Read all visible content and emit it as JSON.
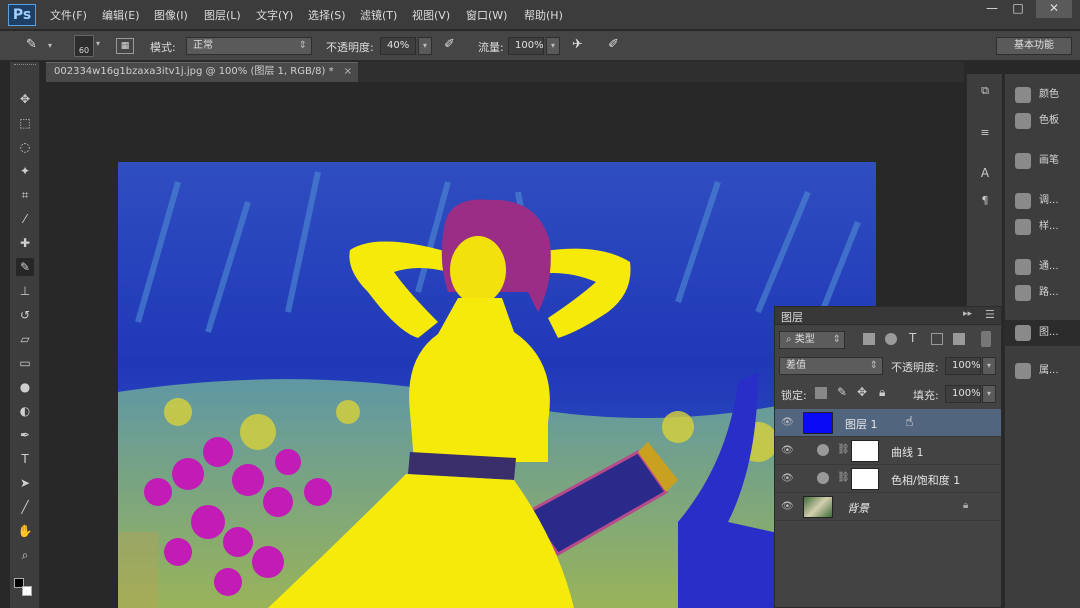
{
  "app": {
    "logo": "Ps"
  },
  "menu": [
    "文件(F)",
    "编辑(E)",
    "图像(I)",
    "图层(L)",
    "文字(Y)",
    "选择(S)",
    "滤镜(T)",
    "视图(V)",
    "窗口(W)",
    "帮助(H)"
  ],
  "window_controls": [
    "—",
    "□",
    "✕"
  ],
  "options": {
    "brush_size": "60",
    "mode_label": "模式:",
    "mode_value": "正常",
    "opacity_label": "不透明度:",
    "opacity_value": "40%",
    "flow_label": "流量:",
    "flow_value": "100%",
    "workspace": "基本功能"
  },
  "document_tab": {
    "title": "002334w16g1bzaxa3itv1j.jpg @ 100% (图层 1, RGB/8) *",
    "close": "×"
  },
  "tools": [
    "move-icon",
    "marquee-icon",
    "lasso-icon",
    "quick-select-icon",
    "crop-icon",
    "eyedropper-icon",
    "healing-icon",
    "brush-icon",
    "stamp-icon",
    "history-brush-icon",
    "eraser-icon",
    "gradient-icon",
    "blur-icon",
    "dodge-icon",
    "pen-icon",
    "text-icon",
    "path-select-icon",
    "line-icon",
    "hand-icon",
    "zoom-icon"
  ],
  "right_panels": [
    {
      "label": "颜色",
      "icon": "color-icon"
    },
    {
      "label": "色板",
      "icon": "swatches-icon"
    },
    {
      "label": "画笔",
      "icon": "brush-panel-icon"
    },
    {
      "label": "调...",
      "icon": "adjustments-icon"
    },
    {
      "label": "样...",
      "icon": "styles-icon"
    },
    {
      "label": "通...",
      "icon": "channels-icon"
    },
    {
      "label": "路...",
      "icon": "paths-icon"
    },
    {
      "label": "图...",
      "icon": "layers-icon"
    },
    {
      "label": "属...",
      "icon": "properties-icon"
    }
  ],
  "layers_panel": {
    "title": "图层",
    "filter_kind": "类型",
    "blend_mode": "差值",
    "opacity_label": "不透明度:",
    "opacity_value": "100%",
    "lock_label": "锁定:",
    "fill_label": "填充:",
    "fill_value": "100%",
    "layers": [
      {
        "name": "图层 1",
        "thumb_color": "#0a0af5",
        "selected": true
      },
      {
        "name": "曲线 1",
        "thumb_color": "#ffffff",
        "selected": false
      },
      {
        "name": "色相/饱和度 1",
        "thumb_color": "#ffffff",
        "selected": false
      },
      {
        "name": "背景",
        "thumb_color": "#3f6b3a",
        "selected": false
      }
    ]
  },
  "colors": {
    "selected_row": "#52657f",
    "accent": "#0a0af5"
  }
}
